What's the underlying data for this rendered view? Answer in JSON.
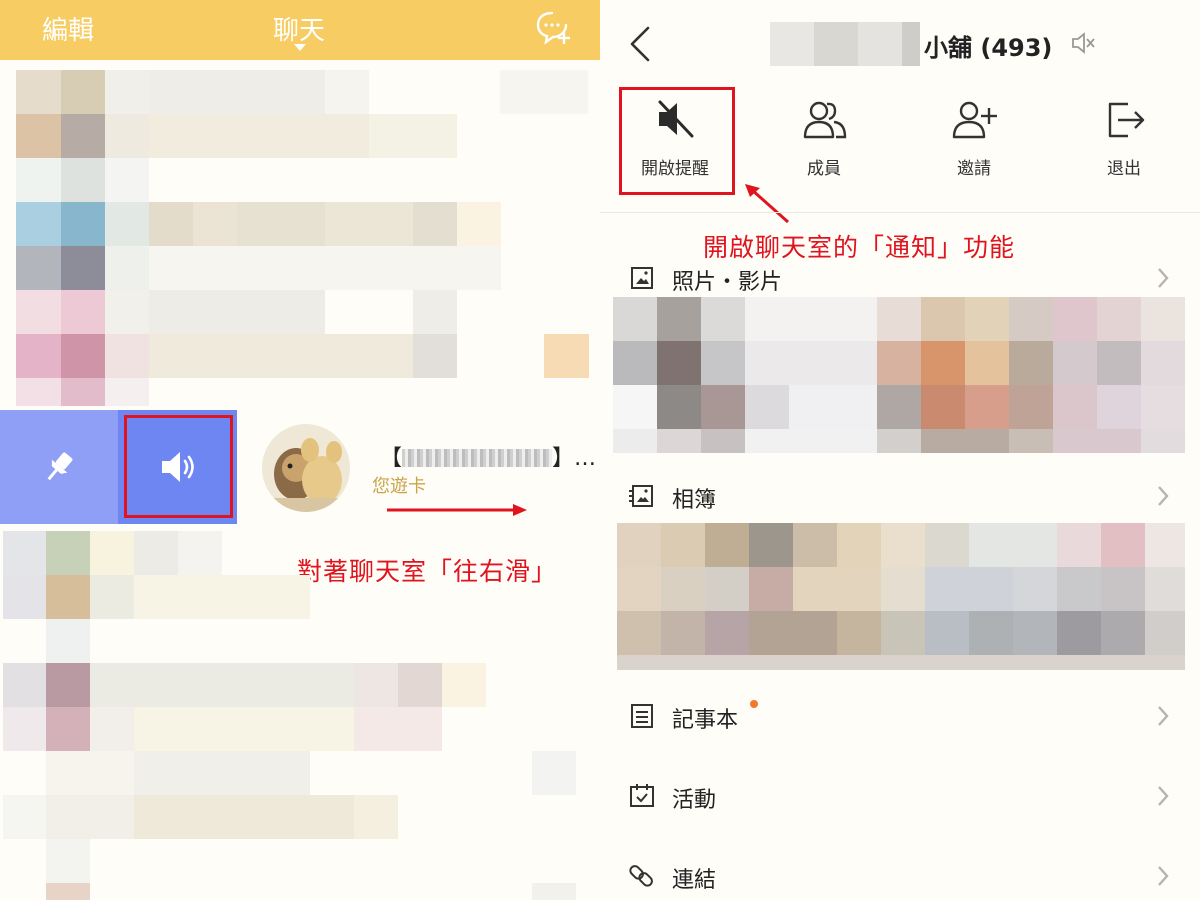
{
  "left_panel": {
    "header": {
      "edit_label": "編輯",
      "title": "聊天",
      "new_chat_icon": "chat-plus-icon"
    },
    "swipe_actions": {
      "pin_icon": "pin-icon",
      "mute_icon": "speaker-icon"
    },
    "chat_item": {
      "name": "【",
      "name_suffix": "】…",
      "preview": "您遊卡"
    },
    "annotation": "對著聊天室「往右滑」"
  },
  "right_panel": {
    "header": {
      "back_icon": "back-chevron-icon",
      "title_prefix": "【",
      "title_suffix": "小舖 (493)",
      "muted_icon": "speaker-muted-icon"
    },
    "actions": [
      {
        "label": "開啟提醒",
        "icon": "speaker-muted-icon"
      },
      {
        "label": "成員",
        "icon": "members-icon"
      },
      {
        "label": "邀請",
        "icon": "add-user-icon"
      },
      {
        "label": "退出",
        "icon": "exit-icon"
      }
    ],
    "annotation": "開啟聊天室的「通知」功能",
    "sections": [
      {
        "label": "照片・影片",
        "icon": "photo-icon"
      },
      {
        "label": "相簿",
        "icon": "album-icon"
      },
      {
        "label": "記事本",
        "icon": "note-icon"
      },
      {
        "label": "活動",
        "icon": "calendar-icon"
      },
      {
        "label": "連結",
        "icon": "link-icon"
      }
    ]
  },
  "colors": {
    "header_yellow": "#f6cc63",
    "pin_action": "#8e9ff5",
    "mute_action": "#6e86f1",
    "annotation_red": "#e0141e",
    "note_badge": "#f07a2c"
  }
}
